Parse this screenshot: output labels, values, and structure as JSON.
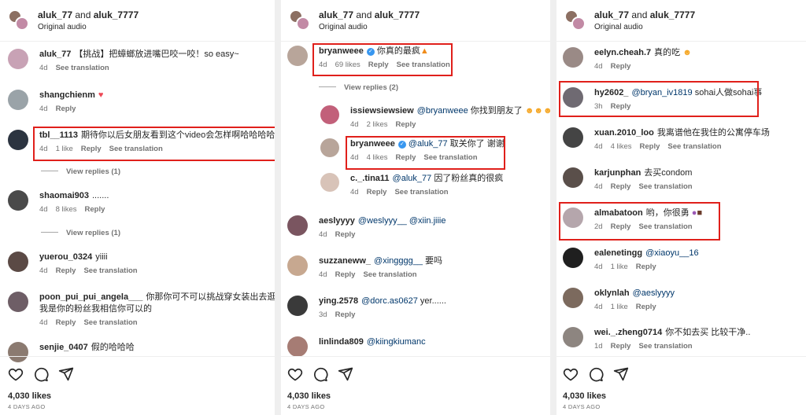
{
  "header": {
    "user_a": "aluk_77",
    "and_text": " and ",
    "user_b": "aluk_7777",
    "audio": "Original audio"
  },
  "footer": {
    "likes": "4,030 likes",
    "ago": "4 DAYS AGO"
  },
  "actions": {
    "reply": "Reply",
    "see_translation": "See translation"
  },
  "panel1": {
    "comments": [
      {
        "user": "aluk_77",
        "text": "【挑战】把蟑螂放进嘴巴咬一咬！so easy~",
        "time": "4d",
        "likes": "",
        "color": "#c8a2b5"
      },
      {
        "user": "shangchienm",
        "text": "",
        "time": "4d",
        "likes": "",
        "color": "#9aa3a8"
      },
      {
        "user": "tbl__1113",
        "text": "期待你以后女朋友看到这个video会怎样啊哈哈哈哈",
        "time": "4d",
        "likes": "1 like",
        "color": "#2c3440"
      },
      {
        "user": "shaomai903",
        "text": ".......",
        "time": "4d",
        "likes": "8 likes",
        "color": "#4a4a4a"
      },
      {
        "user": "yuerou_0324",
        "text": "yiiii",
        "time": "4d",
        "likes": "",
        "color": "#5b4a45"
      },
      {
        "user": "poon_pui_pui_angela___",
        "text": "你那你可不可以挑战穿女装出去逛街",
        "text2": "我是你的粉丝我相信你可以的",
        "time": "4d",
        "likes": "",
        "color": "#6e5e66"
      },
      {
        "user": "senjie_0407",
        "text": "假的哈哈哈",
        "time": "",
        "likes": "",
        "color": "#8b7a70"
      }
    ],
    "view_replies_1": "View replies (1)",
    "view_replies_2": "View replies (1)"
  },
  "panel2": {
    "comments": [
      {
        "user": "bryanweee",
        "text": "你真的最疯",
        "time": "4d",
        "likes": "69 likes",
        "color": "#b8a59a"
      },
      {
        "user": "issiewsiewsiew",
        "mention": "@bryanweee",
        "text": "你找到朋友了",
        "time": "4d",
        "likes": "2 likes",
        "color": "#c2607a"
      },
      {
        "user": "bryanweee",
        "mention": "@aluk_77",
        "text": "取关你了 谢谢",
        "time": "4d",
        "likes": "4 likes",
        "color": "#b8a59a"
      },
      {
        "user": "c._.tina11",
        "mention": "@aluk_77",
        "text": "因了粉丝真的很疯",
        "time": "4d",
        "likes": "",
        "color": "#d8c3b8"
      },
      {
        "user": "aeslyyyy",
        "mention": "@weslyyy__ @xiin.jiiie",
        "text": "",
        "time": "4d",
        "likes": "",
        "color": "#7a5560"
      },
      {
        "user": "suzzaneww_",
        "mention": "@xingggg__",
        "text": "要吗",
        "time": "4d",
        "likes": "",
        "color": "#c7a890"
      },
      {
        "user": "ying.2578",
        "mention": "@dorc.as0627",
        "text": "yer......",
        "time": "3d",
        "likes": "",
        "color": "#3a3a3a"
      },
      {
        "user": "linlinda809",
        "mention": "@kiingkiumanc",
        "text": "",
        "time": "",
        "likes": "",
        "color": "#a67c74"
      }
    ],
    "view_replies": "View replies (2)"
  },
  "panel3": {
    "comments": [
      {
        "user": "eelyn.cheah.7",
        "text": "真的吃",
        "time": "4d",
        "likes": "",
        "color": "#9a8a86"
      },
      {
        "user": "hy2602_",
        "mention": "@bryan_iv1819",
        "text": "sohai人做sohai事",
        "time": "3h",
        "likes": "",
        "color": "#6f6a72"
      },
      {
        "user": "xuan.2010_loo",
        "text": "我离谱他在我住的公寓停车场",
        "time": "4d",
        "likes": "4 likes",
        "color": "#444444"
      },
      {
        "user": "karjunphan",
        "text": "去买condom",
        "time": "4d",
        "likes": "",
        "color": "#5a4f4a"
      },
      {
        "user": "almabatoon",
        "text": "哟，你很勇",
        "time": "2d",
        "likes": "",
        "color": "#b5a6ac"
      },
      {
        "user": "ealenetingg",
        "mention": "@xiaoyu__16",
        "text": "",
        "time": "4d",
        "likes": "1 like",
        "color": "#1f1f1f"
      },
      {
        "user": "oklynlah",
        "mention": "@aeslyyyy",
        "text": "",
        "time": "4d",
        "likes": "1 like",
        "color": "#7c6a5e"
      },
      {
        "user": "wei._.zheng0714",
        "text": "你不如去买 比较干净..",
        "time": "1d",
        "likes": "",
        "color": "#8d8580"
      }
    ]
  },
  "icons": [
    "heart-icon",
    "comment-icon",
    "share-icon",
    "verified-icon",
    "fire-icon",
    "laughing-emoji-icon"
  ]
}
